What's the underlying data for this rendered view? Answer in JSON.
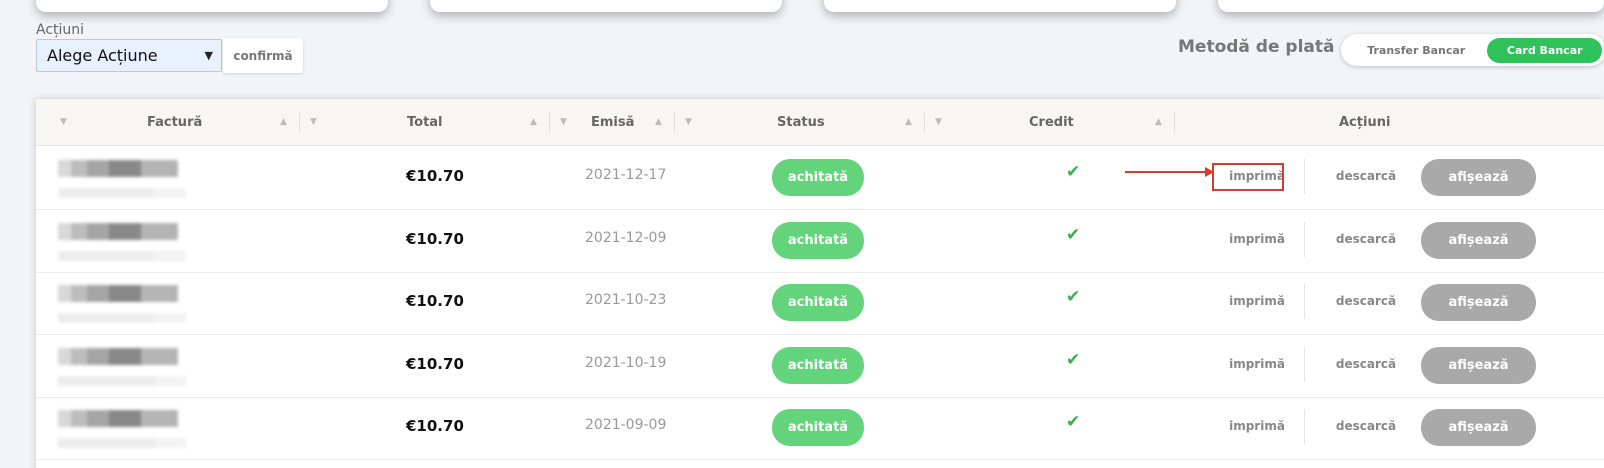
{
  "top_actions": {
    "label": "Acțiuni",
    "select_value": "Alege Acțiune",
    "confirm_label": "confirmă"
  },
  "payment": {
    "label": "Metodă de plată",
    "options": [
      "Transfer Bancar",
      "Card Bancar"
    ],
    "selected": "Card Bancar",
    "accent_color": "#2fc25a"
  },
  "table": {
    "headers": {
      "invoice": "Factură",
      "total": "Total",
      "issued": "Emisă",
      "status": "Status",
      "credit": "Credit",
      "actions": "Acțiuni"
    },
    "rows": [
      {
        "total": "€10.70",
        "date": "2021-12-17",
        "status": "achitată",
        "credit": "✔",
        "print": "imprimă",
        "download": "descarcă",
        "view": "afișează"
      },
      {
        "total": "€10.70",
        "date": "2021-12-09",
        "status": "achitată",
        "credit": "✔",
        "print": "imprimă",
        "download": "descarcă",
        "view": "afișează"
      },
      {
        "total": "€10.70",
        "date": "2021-10-23",
        "status": "achitată",
        "credit": "✔",
        "print": "imprimă",
        "download": "descarcă",
        "view": "afișează"
      },
      {
        "total": "€10.70",
        "date": "2021-10-19",
        "status": "achitată",
        "credit": "✔",
        "print": "imprimă",
        "download": "descarcă",
        "view": "afișează"
      },
      {
        "total": "€10.70",
        "date": "2021-09-09",
        "status": "achitată",
        "credit": "✔",
        "print": "imprimă",
        "download": "descarcă",
        "view": "afișează"
      }
    ],
    "status_color": "#63d47b",
    "credit_color": "#35b34a"
  },
  "annotation": {
    "highlight_color": "#d83a2e",
    "icons": [
      "chevron-down-icon",
      "sort-up-icon",
      "sort-down-icon",
      "checkmark-icon",
      "arrow-right-icon"
    ]
  }
}
